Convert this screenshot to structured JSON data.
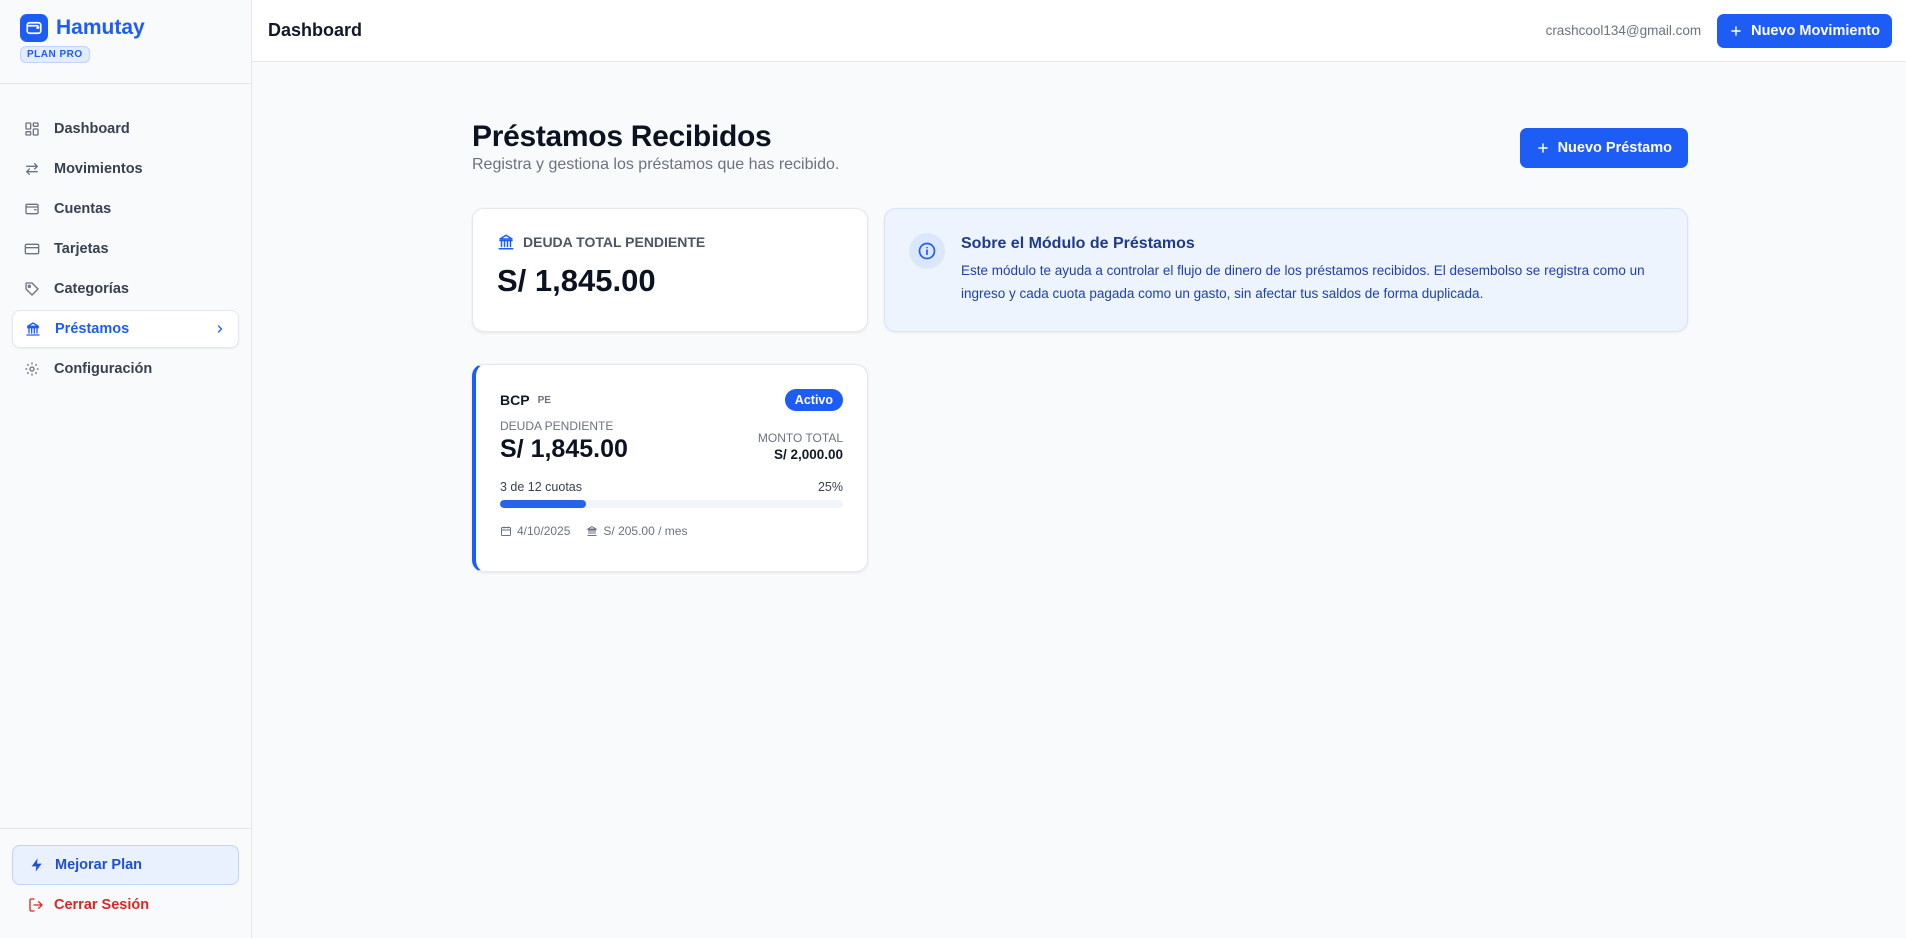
{
  "app": {
    "name": "Hamutay",
    "plan_badge": "PLAN PRO"
  },
  "sidebar": {
    "items": [
      {
        "label": "Dashboard",
        "icon": "dashboard-icon"
      },
      {
        "label": "Movimientos",
        "icon": "arrows-icon"
      },
      {
        "label": "Cuentas",
        "icon": "wallet-icon"
      },
      {
        "label": "Tarjetas",
        "icon": "credit-card-icon"
      },
      {
        "label": "Categorías",
        "icon": "tag-icon"
      },
      {
        "label": "Préstamos",
        "icon": "bank-icon",
        "active": true
      },
      {
        "label": "Configuración",
        "icon": "gear-icon"
      }
    ],
    "upgrade_label": "Mejorar Plan",
    "logout_label": "Cerrar Sesión"
  },
  "header": {
    "title": "Dashboard",
    "email": "crashcool134@gmail.com",
    "new_movement_label": "Nuevo Movimiento"
  },
  "page": {
    "title": "Préstamos Recibidos",
    "subtitle": "Registra y gestiona los préstamos que has recibido.",
    "new_loan_label": "Nuevo Préstamo"
  },
  "summary": {
    "label": "DEUDA TOTAL PENDIENTE",
    "value": "S/ 1,845.00"
  },
  "info": {
    "title": "Sobre el Módulo de Préstamos",
    "text": "Este módulo te ayuda a controlar el flujo de dinero de los préstamos recibidos. El desembolso se registra como un ingreso y cada cuota pagada como un gasto, sin afectar tus saldos de forma duplicada."
  },
  "loans": [
    {
      "bank": "BCP",
      "country": "PE",
      "status": "Activo",
      "pending_label": "DEUDA PENDIENTE",
      "pending_value": "S/ 1,845.00",
      "total_label": "MONTO TOTAL",
      "total_value": "S/ 2,000.00",
      "installments_text": "3 de 12 cuotas",
      "progress_text": "25%",
      "progress": 0.25,
      "date": "4/10/2025",
      "monthly": "S/ 205.00 / mes"
    }
  ],
  "colors": {
    "accent": "#1d5cf5",
    "danger": "#dc2626",
    "info_bg": "#eef4fe"
  }
}
